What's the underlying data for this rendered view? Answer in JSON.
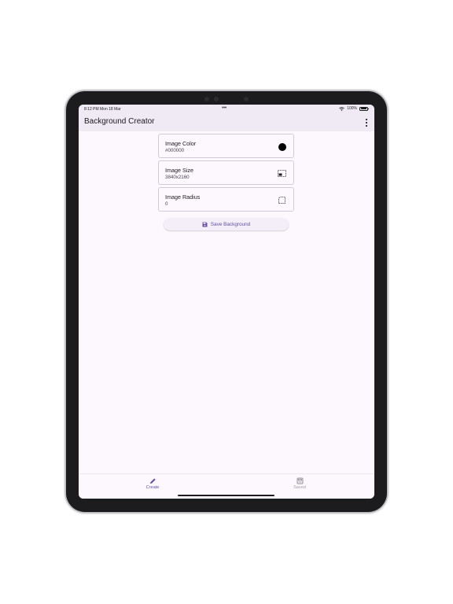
{
  "status_bar": {
    "time_date": "8:12 PM   Mon 18 Mar",
    "battery": "100%"
  },
  "app_bar": {
    "title": "Background Creator",
    "menu_icon": "more-vert-icon"
  },
  "cards": [
    {
      "title": "Image Color",
      "value": "#000000",
      "icon": "filled-circle-icon",
      "swatch_color": "#000000"
    },
    {
      "title": "Image Size",
      "value": "3840x2160",
      "icon": "image-size-icon"
    },
    {
      "title": "Image Radius",
      "value": "0",
      "icon": "rounded-corner-icon"
    }
  ],
  "save_button": {
    "label": "Save Background",
    "icon": "save-icon"
  },
  "bottom_nav": [
    {
      "label": "Create",
      "icon": "pencil-icon",
      "active": true
    },
    {
      "label": "Saved",
      "icon": "saved-icon",
      "active": false
    }
  ],
  "colors": {
    "accent": "#6750a4",
    "surface": "#fdf8fe",
    "app_bar": "#efeaf4"
  }
}
